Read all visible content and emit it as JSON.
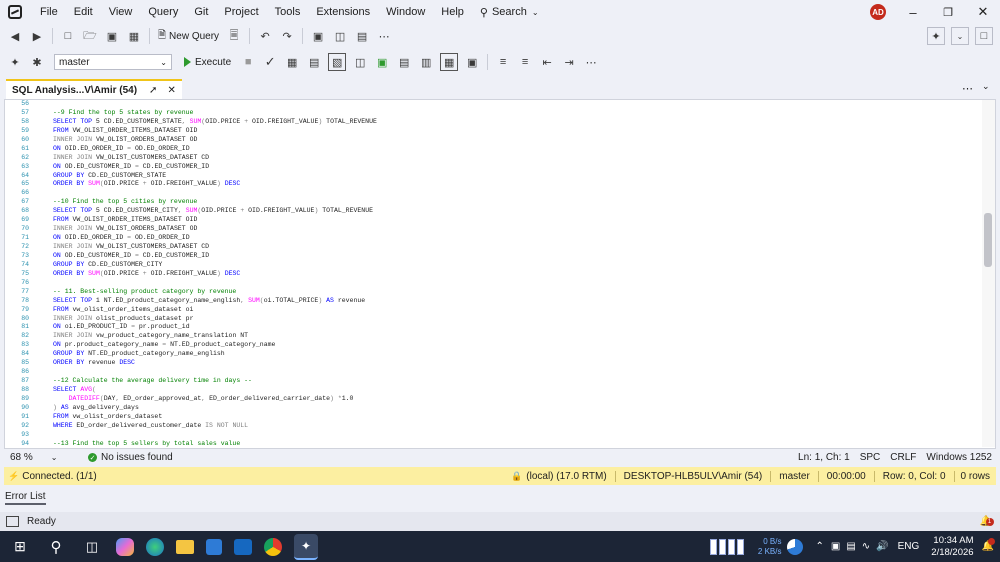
{
  "menu": {
    "items": [
      "File",
      "Edit",
      "View",
      "Query",
      "Git",
      "Project",
      "Tools",
      "Extensions",
      "Window",
      "Help"
    ],
    "search_label": "Search",
    "avatar_initials": "AD"
  },
  "toolbar": {
    "new_query_label": "New Query",
    "database": "master",
    "execute_label": "Execute"
  },
  "tab": {
    "title": "SQL Analysis...V\\Amir (54)"
  },
  "editor": {
    "line_numbers": [
      "56",
      "57",
      "58",
      "59",
      "60",
      "61",
      "62",
      "63",
      "64",
      "65",
      "66",
      "67",
      "68",
      "69",
      "70",
      "71",
      "72",
      "73",
      "74",
      "75",
      "76",
      "77",
      "78",
      "79",
      "80",
      "81",
      "82",
      "83",
      "84",
      "85",
      "86",
      "87",
      "88",
      "89",
      "90",
      "91",
      "92",
      "93",
      "94"
    ],
    "lines": [
      "",
      "--9 Find the top 5 states by revenue",
      "SELECT TOP 5 CD.ED_CUSTOMER_STATE, SUM(OID.PRICE + OID.FREIGHT_VALUE) TOTAL_REVENUE",
      "FROM VW_OLIST_ORDER_ITEMS_DATASET OID",
      "INNER JOIN VW_OLIST_ORDERS_DATASET OD",
      "ON OID.ED_ORDER_ID = OD.ED_ORDER_ID",
      "INNER JOIN VW_OLIST_CUSTOMERS_DATASET CD",
      "ON OD.ED_CUSTOMER_ID = CD.ED_CUSTOMER_ID",
      "GROUP BY CD.ED_CUSTOMER_STATE",
      "ORDER BY SUM(OID.PRICE + OID.FREIGHT_VALUE) DESC",
      "",
      "--10 Find the top 5 cities by revenue",
      "SELECT TOP 5 CD.ED_CUSTOMER_CITY, SUM(OID.PRICE + OID.FREIGHT_VALUE) TOTAL_REVENUE",
      "FROM VW_OLIST_ORDER_ITEMS_DATASET OID",
      "INNER JOIN VW_OLIST_ORDERS_DATASET OD",
      "ON OID.ED_ORDER_ID = OD.ED_ORDER_ID",
      "INNER JOIN VW_OLIST_CUSTOMERS_DATASET CD",
      "ON OD.ED_CUSTOMER_ID = CD.ED_CUSTOMER_ID",
      "GROUP BY CD.ED_CUSTOMER_CITY",
      "ORDER BY SUM(OID.PRICE + OID.FREIGHT_VALUE) DESC",
      "",
      "-- 11. Best-selling product category by revenue",
      "SELECT TOP 1 NT.ED_product_category_name_english, SUM(oi.TOTAL_PRICE) AS revenue",
      "FROM vw_olist_order_items_dataset oi",
      "INNER JOIN olist_products_dataset pr",
      "ON oi.ED_PRODUCT_ID = pr.product_id",
      "INNER JOIN vw_product_category_name_translation NT",
      "ON pr.product_category_name = NT.ED_product_category_name",
      "GROUP BY NT.ED_product_category_name_english",
      "ORDER BY revenue DESC",
      "",
      "--12 Calculate the average delivery time in days --",
      "SELECT AVG(",
      "    DATEDIFF(DAY, ED_order_approved_at, ED_order_delivered_carrier_date) *1.0",
      ") AS avg_delivery_days",
      "FROM vw_olist_orders_dataset",
      "WHERE ED_order_delivered_customer_date IS NOT NULL",
      "",
      "--13 Find the top 5 sellers by total sales value"
    ]
  },
  "editor_status": {
    "zoom": "68 %",
    "issues": "No issues found",
    "position": "Ln: 1, Ch: 1",
    "spc": "SPC",
    "crlf": "CRLF",
    "encoding": "Windows 1252"
  },
  "connection": {
    "status": "Connected. (1/1)",
    "server": "(local) (17.0 RTM)",
    "user": "DESKTOP-HLB5ULV\\Amir (54)",
    "db": "master",
    "elapsed": "00:00:00",
    "rowcol": "Row: 0, Col: 0",
    "rows": "0 rows"
  },
  "error_list": {
    "label": "Error List"
  },
  "status": {
    "text": "Ready",
    "notification_count": "1"
  },
  "taskbar": {
    "net_up": "0 B/s",
    "net_down": "2 KB/s",
    "lang": "ENG",
    "time": "10:34 AM",
    "date": "2/18/2026"
  },
  "colors": {
    "accent_tab": "#f0c419",
    "connection_bar": "#fcefa1",
    "taskbar": "#1c2536",
    "keyword": "#0000ff",
    "comment": "#008000",
    "function": "#ff00ff"
  }
}
